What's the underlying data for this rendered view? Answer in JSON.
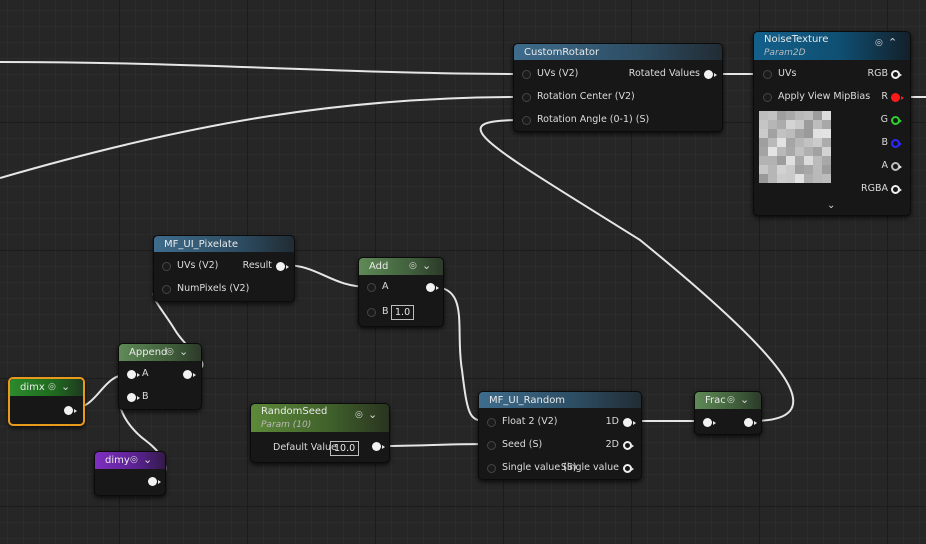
{
  "graph": {
    "nodes": {
      "custom_rotator": {
        "title": "CustomRotator",
        "inputs": [
          "UVs (V2)",
          "Rotation Center (V2)",
          "Rotation Angle (0-1) (S)"
        ],
        "output": "Rotated Values"
      },
      "noise_texture": {
        "title": "NoiseTexture",
        "subtitle": "Param2D",
        "inputs": [
          "UVs",
          "Apply View MipBias"
        ],
        "outputs": [
          "RGB",
          "R",
          "G",
          "B",
          "A",
          "RGBA"
        ],
        "channel_colors": {
          "R": "#ff1a1a",
          "G": "#2ed12e",
          "B": "#2a2aff"
        }
      },
      "pixelate": {
        "title": "MF_UI_Pixelate",
        "inputs": [
          "UVs (V2)",
          "NumPixels (V2)"
        ],
        "output": "Result"
      },
      "add": {
        "title": "Add",
        "input_a": "A",
        "input_b": "B",
        "b_value": "1.0"
      },
      "append": {
        "title": "Append",
        "input_a": "A",
        "input_b": "B"
      },
      "dimx": {
        "title": "dimx"
      },
      "dimy": {
        "title": "dimy"
      },
      "random_seed": {
        "title": "RandomSeed",
        "subtitle": "Param (10)",
        "label": "Default Value",
        "value": "10.0"
      },
      "random": {
        "title": "MF_UI_Random",
        "inputs": [
          "Float 2 (V2)",
          "Seed (S)",
          "Single value (S)"
        ],
        "outputs": [
          "1D",
          "2D",
          "Single value"
        ]
      },
      "frac": {
        "title": "Frac"
      }
    },
    "colors": {
      "selected_outline": "#e89a1c",
      "grid_background": "#262626",
      "wire": "#e6e6e6"
    },
    "icons": {
      "expand": "chevron-down-icon",
      "collapse": "chevron-up-icon",
      "preview_toggle": "circle-toggle-icon"
    }
  }
}
